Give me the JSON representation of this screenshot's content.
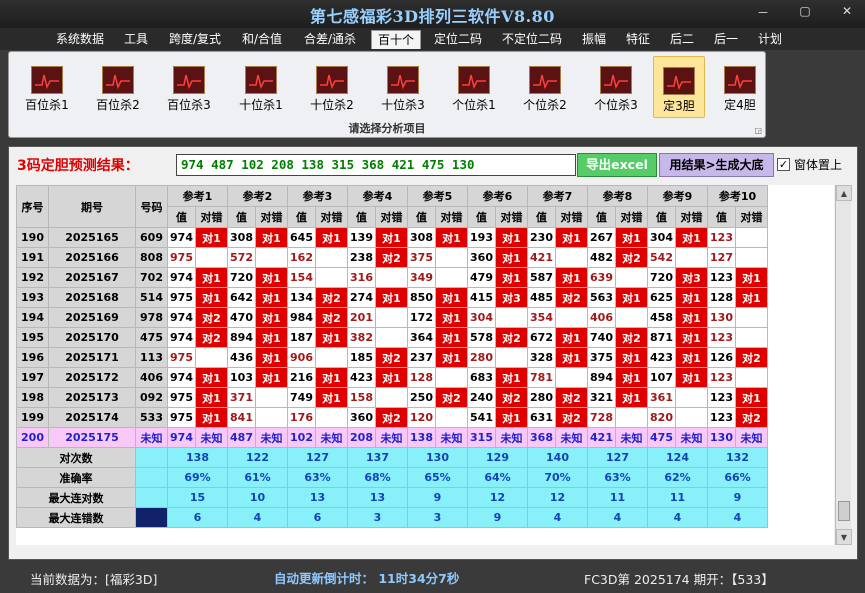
{
  "window": {
    "title": "第七感福彩3D排列三软件V8.80",
    "controls": [
      "－",
      "▢",
      "✕"
    ]
  },
  "menu": [
    "系统数据",
    "工具",
    "跨度/复式",
    "和/合值",
    "合差/通杀",
    "百十个",
    "定位二码",
    "不定位二码",
    "振幅",
    "特征",
    "后二",
    "后一",
    "计划"
  ],
  "menu_active_index": 5,
  "ribbon": {
    "buttons": [
      "百位杀1",
      "百位杀2",
      "百位杀3",
      "十位杀1",
      "十位杀2",
      "十位杀3",
      "个位杀1",
      "个位杀2",
      "个位杀3",
      "定3胆",
      "定4胆"
    ],
    "selected_index": 9,
    "group_label": "请选择分析项目"
  },
  "prediction": {
    "label": "3码定胆预测结果：",
    "value": "974 487 102 208 138 315 368 421 475 130",
    "export_button": "导出excel",
    "generate_button": "用结果>生成大底",
    "topmost_checkbox": {
      "label": "窗体置上",
      "checked": true
    }
  },
  "table": {
    "headers": {
      "index": "序号",
      "issue": "期号",
      "number": "号码",
      "value": "值",
      "verdict": "对错"
    },
    "refs": [
      "参考1",
      "参考2",
      "参考3",
      "参考4",
      "参考5",
      "参考6",
      "参考7",
      "参考8",
      "参考9",
      "参考10"
    ],
    "rows": [
      {
        "seq": "190",
        "issue": "2025165",
        "num": "609",
        "cells": [
          [
            "974",
            "对1"
          ],
          [
            "308",
            "对1"
          ],
          [
            "645",
            "对1"
          ],
          [
            "139",
            "对1"
          ],
          [
            "308",
            "对1"
          ],
          [
            "193",
            "对1"
          ],
          [
            "230",
            "对1"
          ],
          [
            "267",
            "对1"
          ],
          [
            "304",
            "对1"
          ],
          [
            "123",
            ""
          ]
        ]
      },
      {
        "seq": "191",
        "issue": "2025166",
        "num": "808",
        "cells": [
          [
            "975",
            ""
          ],
          [
            "572",
            ""
          ],
          [
            "162",
            ""
          ],
          [
            "238",
            "对2"
          ],
          [
            "375",
            ""
          ],
          [
            "360",
            "对1"
          ],
          [
            "421",
            ""
          ],
          [
            "482",
            "对2"
          ],
          [
            "542",
            ""
          ],
          [
            "127",
            ""
          ]
        ]
      },
      {
        "seq": "192",
        "issue": "2025167",
        "num": "702",
        "cells": [
          [
            "974",
            "对1"
          ],
          [
            "720",
            "对1"
          ],
          [
            "154",
            ""
          ],
          [
            "316",
            ""
          ],
          [
            "349",
            ""
          ],
          [
            "479",
            "对1"
          ],
          [
            "587",
            "对1"
          ],
          [
            "639",
            ""
          ],
          [
            "720",
            "对3"
          ],
          [
            "123",
            "对1"
          ]
        ]
      },
      {
        "seq": "193",
        "issue": "2025168",
        "num": "514",
        "cells": [
          [
            "975",
            "对1"
          ],
          [
            "642",
            "对1"
          ],
          [
            "134",
            "对2"
          ],
          [
            "274",
            "对1"
          ],
          [
            "850",
            "对1"
          ],
          [
            "415",
            "对3"
          ],
          [
            "485",
            "对2"
          ],
          [
            "563",
            "对1"
          ],
          [
            "625",
            "对1"
          ],
          [
            "128",
            "对1"
          ]
        ]
      },
      {
        "seq": "194",
        "issue": "2025169",
        "num": "978",
        "cells": [
          [
            "974",
            "对2"
          ],
          [
            "470",
            "对1"
          ],
          [
            "984",
            "对2"
          ],
          [
            "201",
            ""
          ],
          [
            "172",
            "对1"
          ],
          [
            "304",
            ""
          ],
          [
            "354",
            ""
          ],
          [
            "406",
            ""
          ],
          [
            "458",
            "对1"
          ],
          [
            "130",
            ""
          ]
        ]
      },
      {
        "seq": "195",
        "issue": "2025170",
        "num": "475",
        "cells": [
          [
            "974",
            "对2"
          ],
          [
            "894",
            "对1"
          ],
          [
            "187",
            "对1"
          ],
          [
            "382",
            ""
          ],
          [
            "364",
            "对1"
          ],
          [
            "578",
            "对2"
          ],
          [
            "672",
            "对1"
          ],
          [
            "740",
            "对2"
          ],
          [
            "871",
            "对1"
          ],
          [
            "123",
            ""
          ]
        ]
      },
      {
        "seq": "196",
        "issue": "2025171",
        "num": "113",
        "cells": [
          [
            "975",
            ""
          ],
          [
            "436",
            "对1"
          ],
          [
            "906",
            ""
          ],
          [
            "185",
            "对2"
          ],
          [
            "237",
            "对1"
          ],
          [
            "280",
            ""
          ],
          [
            "328",
            "对1"
          ],
          [
            "375",
            "对1"
          ],
          [
            "423",
            "对1"
          ],
          [
            "126",
            "对2"
          ]
        ]
      },
      {
        "seq": "197",
        "issue": "2025172",
        "num": "406",
        "cells": [
          [
            "974",
            "对1"
          ],
          [
            "103",
            "对1"
          ],
          [
            "216",
            "对1"
          ],
          [
            "423",
            "对1"
          ],
          [
            "128",
            ""
          ],
          [
            "683",
            "对1"
          ],
          [
            "781",
            ""
          ],
          [
            "894",
            "对1"
          ],
          [
            "107",
            "对1"
          ],
          [
            "123",
            ""
          ]
        ]
      },
      {
        "seq": "198",
        "issue": "2025173",
        "num": "092",
        "cells": [
          [
            "975",
            "对1"
          ],
          [
            "371",
            ""
          ],
          [
            "749",
            "对1"
          ],
          [
            "158",
            ""
          ],
          [
            "250",
            "对2"
          ],
          [
            "240",
            "对2"
          ],
          [
            "280",
            "对2"
          ],
          [
            "321",
            "对1"
          ],
          [
            "361",
            ""
          ],
          [
            "123",
            "对1"
          ]
        ]
      },
      {
        "seq": "199",
        "issue": "2025174",
        "num": "533",
        "cells": [
          [
            "975",
            "对1"
          ],
          [
            "841",
            ""
          ],
          [
            "176",
            ""
          ],
          [
            "360",
            "对2"
          ],
          [
            "120",
            ""
          ],
          [
            "541",
            "对1"
          ],
          [
            "631",
            "对2"
          ],
          [
            "728",
            ""
          ],
          [
            "820",
            ""
          ],
          [
            "123",
            "对2"
          ]
        ]
      }
    ],
    "prediction_row": {
      "seq": "200",
      "issue": "2025175",
      "num": "未知",
      "cells": [
        [
          "974",
          "未知"
        ],
        [
          "487",
          "未知"
        ],
        [
          "102",
          "未知"
        ],
        [
          "208",
          "未知"
        ],
        [
          "138",
          "未知"
        ],
        [
          "315",
          "未知"
        ],
        [
          "368",
          "未知"
        ],
        [
          "421",
          "未知"
        ],
        [
          "475",
          "未知"
        ],
        [
          "130",
          "未知"
        ]
      ]
    },
    "stats": [
      {
        "label": "对次数",
        "values": [
          "138",
          "122",
          "127",
          "137",
          "130",
          "129",
          "140",
          "127",
          "124",
          "132"
        ]
      },
      {
        "label": "准确率",
        "values": [
          "69%",
          "61%",
          "63%",
          "68%",
          "65%",
          "64%",
          "70%",
          "63%",
          "62%",
          "66%"
        ]
      },
      {
        "label": "最大连对数",
        "values": [
          "15",
          "10",
          "13",
          "13",
          "9",
          "12",
          "12",
          "11",
          "11",
          "9"
        ]
      },
      {
        "label": "最大连错数",
        "values": [
          "6",
          "4",
          "6",
          "3",
          "3",
          "9",
          "4",
          "4",
          "4",
          "4"
        ]
      }
    ]
  },
  "status": {
    "data_source": "当前数据为：[福彩3D]",
    "countdown": "自动更新倒计时： 11时34分7秒",
    "draw_info": "FC3D第 2025174 期开：【533】"
  },
  "colors": {
    "hit": "#e00000",
    "miss_text": "#a01818",
    "pred_row": "#f8c8f8",
    "stats": "#88f0f8",
    "export": "#55cc66",
    "generate": "#c7b8ea"
  }
}
